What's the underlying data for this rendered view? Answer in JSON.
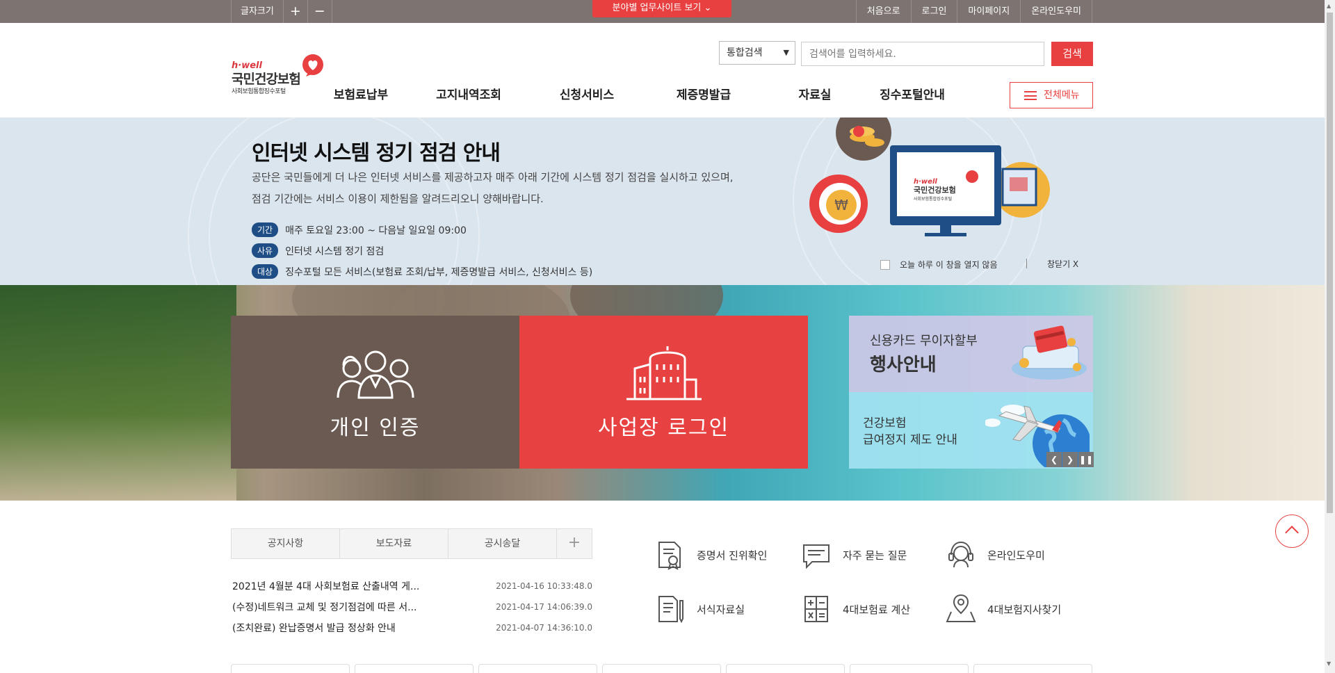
{
  "topbar": {
    "font_size_label": "글자크기",
    "increase": "+",
    "decrease": "−",
    "site_button": "분야별 업무사이트 보기",
    "links": [
      "처음으로",
      "로그인",
      "마이페이지",
      "온라인도우미"
    ]
  },
  "logo": {
    "eng": "h·well",
    "kor": "국민건강보험",
    "sub": "사회보험통합징수포털"
  },
  "search": {
    "select_value": "통합검색",
    "placeholder": "검색어를 입력하세요.",
    "button": "검색"
  },
  "gnb": [
    "보험료납부",
    "고지내역조회",
    "신청서비스",
    "제증명발급",
    "자료실",
    "징수포털안내"
  ],
  "all_menu": "전체메뉴",
  "notice": {
    "title": "인터넷 시스템 정기 점검 안내",
    "desc1": "공단은 국민들에게 더 나은 인터넷 서비스를 제공하고자 매주 아래 기간에 시스템 정기 점검을 실시하고 있으며,",
    "desc2": "점검 기간에는 서비스 이용이 제한됨을 알려드리오니 양해바랍니다.",
    "rows": [
      {
        "tag": "기간",
        "text": "매주 토요일 23:00 ~ 다음날 일요일 09:00"
      },
      {
        "tag": "사유",
        "text": "인터넷 시스템 정기 점검"
      },
      {
        "tag": "대상",
        "text": "징수포털 모든 서비스(보험료 조회/납부, 제증명발급 서비스, 신청서비스 등)"
      }
    ],
    "no_show_today": "오늘 하루 이 창을 열지 않음",
    "close": "창닫기 X",
    "illustration_logo_eng": "h·well",
    "illustration_logo_kor": "국민건강보험",
    "illustration_logo_sub": "사회보험통합징수포털"
  },
  "hero": {
    "personal": "개인 인증",
    "business": "사업장 로그인",
    "side1_line1": "신용카드 무이자할부",
    "side1_line2": "행사안내",
    "side2_line1": "건강보험",
    "side2_line2": "급여정지 제도 안내"
  },
  "board": {
    "tabs": [
      "공지사항",
      "보도자료",
      "공시송달"
    ],
    "more": "+",
    "items": [
      {
        "title": "2021년 4월분 4대 사회보험료 산출내역 게...",
        "date": "2021-04-16 10:33:48.0"
      },
      {
        "title": "(수정)네트워크 교체 및 정기점검에 따른 서...",
        "date": "2021-04-17 14:06:39.0"
      },
      {
        "title": "(조치완료) 완납증명서 발급 정상화 안내",
        "date": "2021-04-07 14:36:10.0"
      }
    ]
  },
  "quick": {
    "cert_verify": "증명서 진위확인",
    "faq": "자주 묻는 질문",
    "helper": "온라인도우미",
    "forms": "서식자료실",
    "calc": "4대보험료 계산",
    "branch": "4대보험지사찾기"
  },
  "colors": {
    "accent": "#e84040",
    "topbar": "#7d7370",
    "notice_bg": "#dbe5ee",
    "tag": "#1f4e86",
    "personal_card": "#6b5a52"
  }
}
